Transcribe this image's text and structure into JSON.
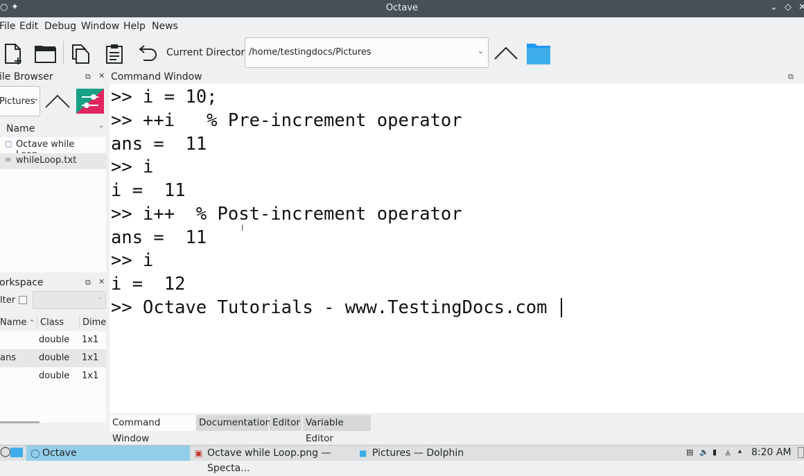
{
  "window": {
    "title": "Octave"
  },
  "menubar": {
    "items": [
      "File",
      "Edit",
      "Debug",
      "Window",
      "Help",
      "News"
    ]
  },
  "toolbar": {
    "current_directory_label": "Current Directory:",
    "current_directory_value": "/home/testingdocs/Pictures"
  },
  "file_browser": {
    "title": "ile Browser",
    "location": "Pictures",
    "column_header": "Name",
    "files": [
      {
        "name": "Octave while Loop....",
        "icon": "image-file-icon"
      },
      {
        "name": "whileLoop.txt",
        "icon": "text-file-icon"
      }
    ]
  },
  "workspace": {
    "title": "orkspace",
    "filter_label": "lter",
    "columns": [
      "Name",
      "Class",
      "Dime"
    ],
    "rows": [
      {
        "name": "",
        "class": "double",
        "dim": "1x1"
      },
      {
        "name": "ans",
        "class": "double",
        "dim": "1x1"
      },
      {
        "name": "",
        "class": "double",
        "dim": "1x1"
      }
    ]
  },
  "command_window": {
    "title": "Command Window",
    "lines": [
      ">> i = 10;",
      ">> ++i   % Pre-increment operator",
      "ans =  11",
      ">> i",
      "i =  11",
      ">> i++  % Post-increment operator",
      "ans =  11",
      ">> i",
      "i =  12",
      ">> Octave Tutorials - www.TestingDocs.com"
    ]
  },
  "bottom_tabs": [
    "Command Window",
    "Documentation",
    "Editor",
    "Variable Editor"
  ],
  "taskbar": {
    "tasks": [
      "Octave",
      "Octave while Loop.png — Specta...",
      "Pictures — Dolphin"
    ],
    "clock": "8:20 AM"
  },
  "colors": {
    "titlebar": "#475057",
    "selection": "#93cee9",
    "folder": "#3daee9"
  }
}
